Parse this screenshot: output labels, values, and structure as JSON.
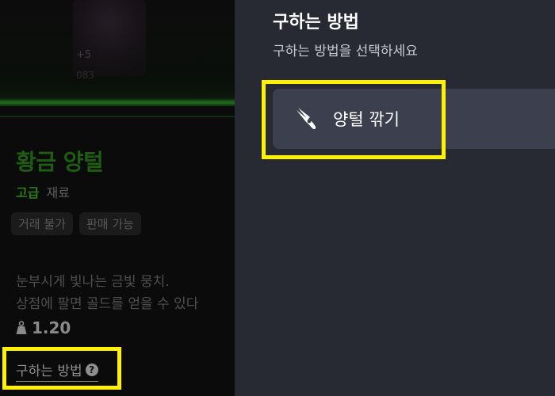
{
  "item": {
    "thumb_stat": "+5",
    "thumb_stat2": "083",
    "name": "황금 양털",
    "grade": "고급",
    "category": "재료",
    "tags": [
      "거래 불가",
      "판매 가능"
    ],
    "description_lines": [
      "눈부시게 빛나는 금빛 뭉치.",
      "상점에 팔면 골드를 얻을 수 있다"
    ],
    "weight": "1.20",
    "how_to_get_link": "구하는 방법",
    "help_glyph": "?"
  },
  "acquire": {
    "title": "구하는 방법",
    "subtitle": "구하는 방법을 선택하세요",
    "methods": [
      {
        "label": "양털 깎기",
        "icon": "shears-icon"
      }
    ]
  },
  "colors": {
    "highlight": "#fff200",
    "panel_bg": "#272a33",
    "button_bg": "#3b3f4e",
    "item_name": "#1f5c14"
  }
}
